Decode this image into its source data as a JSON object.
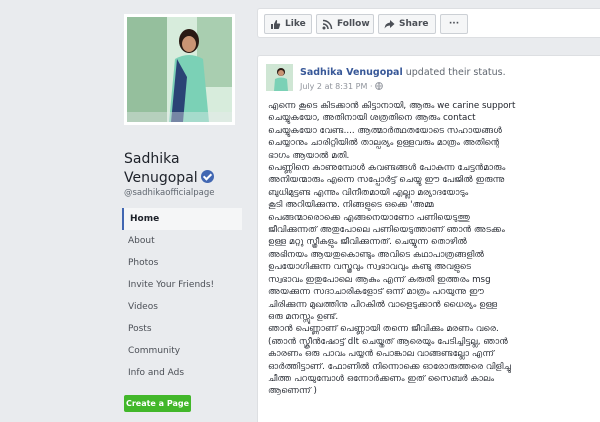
{
  "page": {
    "name": "Sadhika Venugopal",
    "handle": "@sadhikaofficialpage"
  },
  "nav": {
    "items": [
      {
        "label": "Home"
      },
      {
        "label": "About"
      },
      {
        "label": "Photos"
      },
      {
        "label": "Invite Your Friends!"
      },
      {
        "label": "Videos"
      },
      {
        "label": "Posts"
      },
      {
        "label": "Community"
      },
      {
        "label": "Info and Ads"
      }
    ],
    "create_label": "Create a Page"
  },
  "toolbar": {
    "like_label": "Like",
    "follow_label": "Follow",
    "share_label": "Share",
    "more_label": "···"
  },
  "post": {
    "author": "Sadhika Venugopal",
    "action": "updated their status.",
    "date": "July 2 at 8:31 PM",
    "text": "എന്നെ കൂടെ കിടക്കാൻ കിട്ടാനായി, ആരും we carine support\nചെയ്യുകയോ, അതിനായി ശത്രതിനെ ആരും contact\nചെയ്യുകയോ വേണ്ട.... ആത്മാർത്ഥതയോടെ സഹായങ്ങൾ\nചെയ്യാനും ചാരിറ്റിയിൽ താല്പര്യം ഉള്ളവരും മാത്രം അതിന്റെ\nഭാഗം ആയാൽ മതി.\nപെണ്ണിനെ കാണുമ്പോൾ കവണ്ടങ്ങൾ പോകുന്ന ചേട്ടൻമാരും\nഅനിയന്മാരും എന്നെ സപ്പോർട്ട് ചെയ്യു ഈ പേജിൽ ഇരുന്നു\nബുധിമുട്ടണ്ട എന്നും വിനീതമായി എല്ലാ മര്യാദയോടും\nകൂടി അറിയിക്കുന്നു. നിങ്ങളുടെ ഒക്കെ 'അമ്മ\nപെങ്ങന്മാരൊക്കെ എങ്ങനെയാണോ പണിയെടുത്തു\nജീവിക്കുന്നത് അതുപോലെ പണിയെടുത്താണ് ഞാൻ അടക്കം\nഉള്ള മറ്റു സ്ത്രീകളും ജീവിക്കുന്നത്. ചെയ്യുന്ന തൊഴിൽ\nഅഭിനയം ആയതുകൊണ്ടും അവിടെ കഥാപാത്രങ്ങളിൽ\nഉപയോഗിക്കുന്ന വസ്ത്രവും സ്വഭാവവും കണ്ടു അവളുടെ\nസ്വഭാവം ഇതുപോലെ ആകും എന്ന് കരുതി ഇത്തരം msg\nഅയക്കുന്ന സദാചാരികളോട് ഒന്ന് മാത്രം പറയുന്നു ഈ\nചിരിക്കുന്ന മുഖത്തിനു പിറകിൽ വാളെടുക്കാൻ ധൈര്യം ഉള്ള\nഒരു മനസ്സും ഉണ്ട്.\nഞാൻ പെണ്ണാണ് പെണ്ണായി തന്നെ ജീവിക്കും മരണം വരെ.\n(ഞാൻ സ്ക്രീൻഷോട്ട് dlt ചെയ്തത് ആരെയും പേടിച്ചിട്ടല്ല, ഞാൻ\nകാരണം ഒരു പാവം പയ്യൻ പൊങ്കാല വാങ്ങണ്ടല്ലോ എന്ന്\nഓർത്തിട്ടാണ്. ഫോണിൽ നിന്നൊക്കെ ഓരോരുത്തരെ വിളിച്ചു\nചീത്ത പറയുമ്പോൾ ഒന്നോർക്കണം ഇത് സൈബർ കാലം\nആണെന്ന് )"
  },
  "colors": {
    "link": "#385898",
    "accent": "#4267b2",
    "create_button": "#42b72a",
    "background": "#e9ebee"
  },
  "icons": [
    "thumbs-up-icon",
    "rss-follow-icon",
    "share-arrow-icon",
    "verified-badge-icon",
    "globe-icon"
  ]
}
